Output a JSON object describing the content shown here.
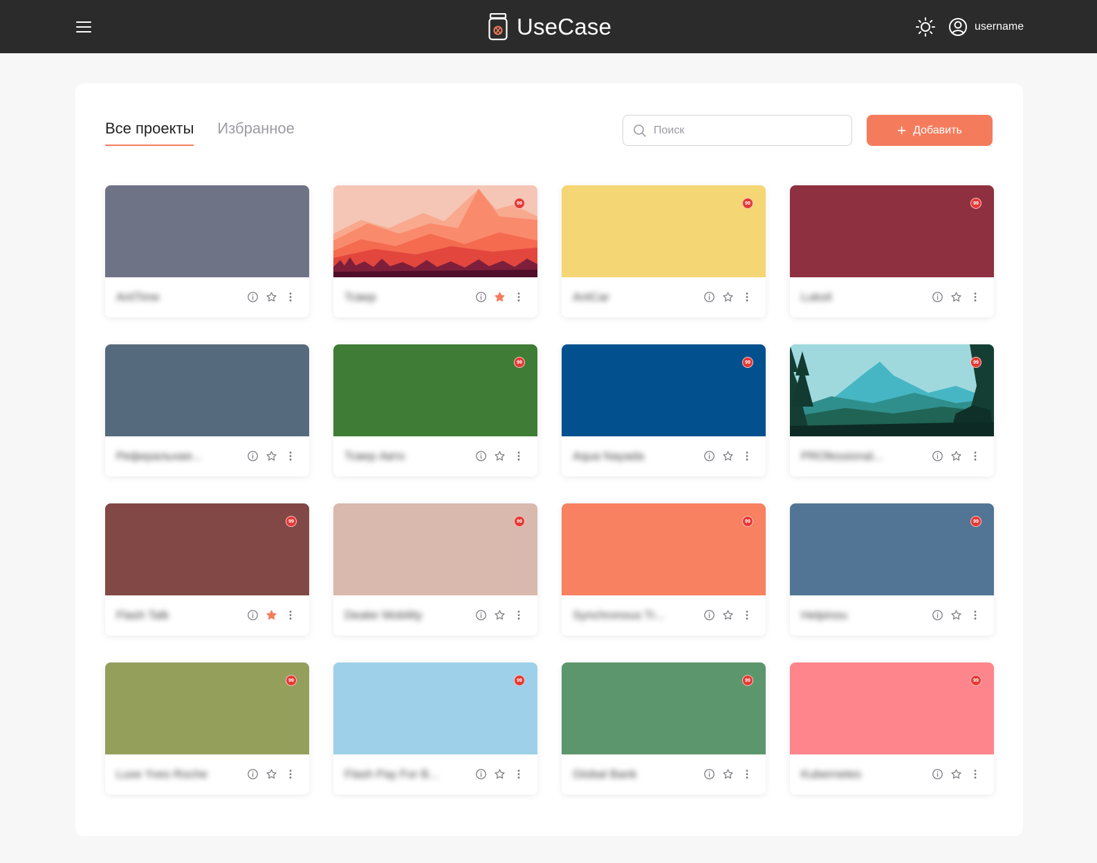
{
  "header": {
    "app_title": "UseCase",
    "username": "username"
  },
  "tabs": [
    {
      "label": "Все проекты",
      "active": true
    },
    {
      "label": "Избранное",
      "active": false
    }
  ],
  "search": {
    "placeholder": "Поиск",
    "value": ""
  },
  "add_button": {
    "label": "Добавить"
  },
  "accent_color": "#f47c5d",
  "projects": [
    {
      "name": "AntTime",
      "cover_color": "#6e7386",
      "badge": "",
      "favorite": false
    },
    {
      "name": "Тсвер",
      "cover_color": "#f5c6b5",
      "cover_scene": "mountains",
      "badge": "99",
      "favorite": true
    },
    {
      "name": "AntCar",
      "cover_color": "#f4d675",
      "badge": "99",
      "favorite": false
    },
    {
      "name": "Lukoil",
      "cover_color": "#8e3040",
      "badge": "99",
      "favorite": false
    },
    {
      "name": "Реферальная...",
      "cover_color": "#556a7d",
      "badge": "",
      "favorite": false
    },
    {
      "name": "Тсвер Авто",
      "cover_color": "#3f7d36",
      "badge": "99",
      "favorite": false
    },
    {
      "name": "Aqua Nayada",
      "cover_color": "#03508f",
      "badge": "99",
      "favorite": false
    },
    {
      "name": "PROfessional...",
      "cover_color": "#47b6c4",
      "cover_scene": "forest",
      "badge": "99",
      "favorite": false
    },
    {
      "name": "Flash Talk",
      "cover_color": "#824845",
      "badge": "99",
      "favorite": true
    },
    {
      "name": "Dealer Mobility",
      "cover_color": "#d9b8ad",
      "badge": "99",
      "favorite": false
    },
    {
      "name": "Synchronous Tr...",
      "cover_color": "#f78160",
      "badge": "99",
      "favorite": false
    },
    {
      "name": "Helpinou",
      "cover_color": "#527595",
      "badge": "99",
      "favorite": false
    },
    {
      "name": "Luxe Yves Roche",
      "cover_color": "#949f5c",
      "badge": "99",
      "favorite": false
    },
    {
      "name": "Flash Pay For B...",
      "cover_color": "#9ed0ea",
      "badge": "99",
      "favorite": false
    },
    {
      "name": "Global Bank",
      "cover_color": "#5c966c",
      "badge": "99",
      "favorite": false
    },
    {
      "name": "Kubernetes",
      "cover_color": "#fe858c",
      "badge": "99",
      "favorite": false
    }
  ]
}
